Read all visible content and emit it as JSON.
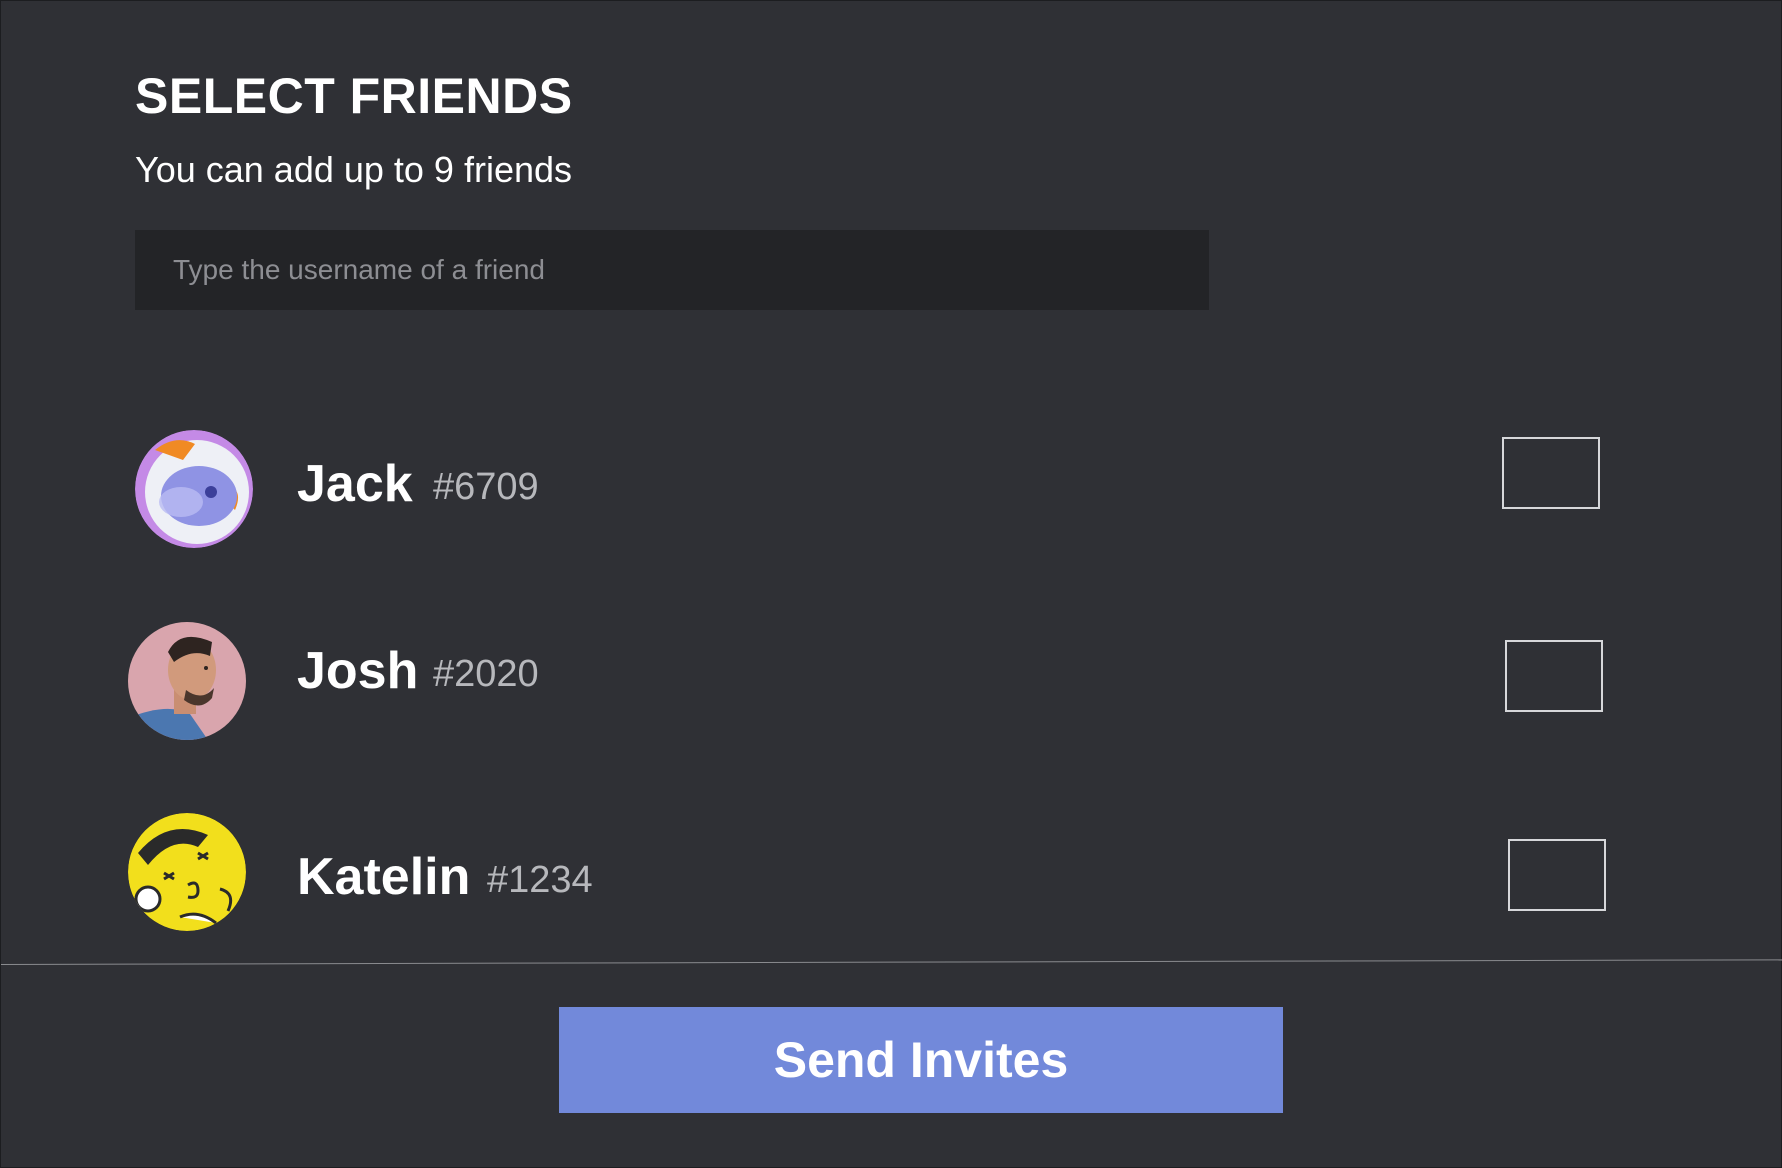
{
  "header": {
    "title": "SELECT FRIENDS",
    "subtitle": "You can add up to 9 friends"
  },
  "search": {
    "placeholder": "Type the username of a friend",
    "value": ""
  },
  "friends": [
    {
      "name": "Jack",
      "tag": "#6709",
      "avatar": "robot-helmet-avatar",
      "checked": false
    },
    {
      "name": "Josh",
      "tag": "#2020",
      "avatar": "man-portrait-avatar",
      "checked": false
    },
    {
      "name": "Katelin",
      "tag": "#1234",
      "avatar": "cartoon-character-avatar",
      "checked": false
    }
  ],
  "footer": {
    "send_label": "Send Invites"
  },
  "colors": {
    "background": "#2f3035",
    "input_background": "#232427",
    "accent": "#7289da",
    "tag_text": "#b7b8bc"
  }
}
